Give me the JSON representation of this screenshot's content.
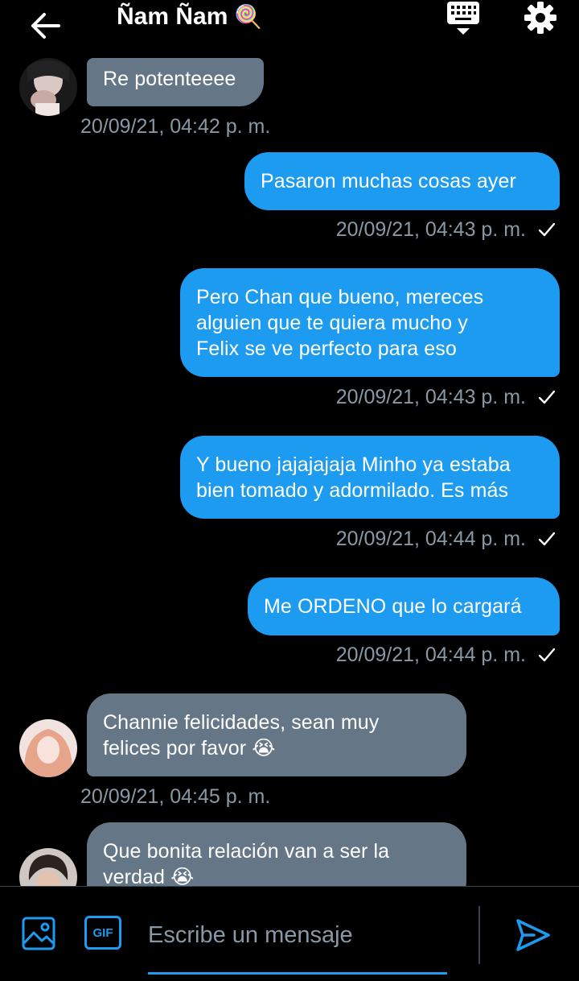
{
  "header": {
    "title": "Ñam Ñam",
    "title_emoji": "🍭",
    "back_icon": "arrow-left-icon",
    "keyboard_icon": "keyboard-icon",
    "settings_icon": "gear-icon"
  },
  "messages": [
    {
      "direction": "in",
      "lines": [
        "Re potenteeee"
      ],
      "timestamp": "20/09/21, 04:42 p. m."
    },
    {
      "direction": "out",
      "lines": [
        "Pasaron muchas cosas ayer"
      ],
      "timestamp": "20/09/21, 04:43 p. m."
    },
    {
      "direction": "out",
      "lines": [
        "Pero Chan que bueno, mereces",
        "alguien que te quiera mucho y",
        "Felix se ve perfecto para eso"
      ],
      "timestamp": "20/09/21, 04:43 p. m."
    },
    {
      "direction": "out",
      "lines": [
        "Y bueno jajajajaja Minho ya estaba",
        "bien tomado y adormilado. Es más"
      ],
      "timestamp": "20/09/21, 04:44 p. m."
    },
    {
      "direction": "out",
      "lines": [
        "Me ORDENO que lo cargará"
      ],
      "timestamp": "20/09/21, 04:44 p. m."
    },
    {
      "direction": "in",
      "lines": [
        "Channie felicidades, sean muy",
        "felices por favor 😭"
      ],
      "timestamp": "20/09/21, 04:45 p. m."
    },
    {
      "direction": "in",
      "lines": [
        "Que bonita relación van a ser la",
        "verdad 😭"
      ],
      "timestamp": ""
    }
  ],
  "composer": {
    "placeholder": "Escribe un mensaje",
    "gif_label": "GIF",
    "media_icon": "image-icon",
    "send_icon": "send-icon"
  },
  "colors": {
    "background": "#000000",
    "outgoing_bubble": "#1d9bf0",
    "incoming_bubble": "#657786",
    "timestamp": "#8899a6",
    "accent": "#1d9bf0"
  }
}
